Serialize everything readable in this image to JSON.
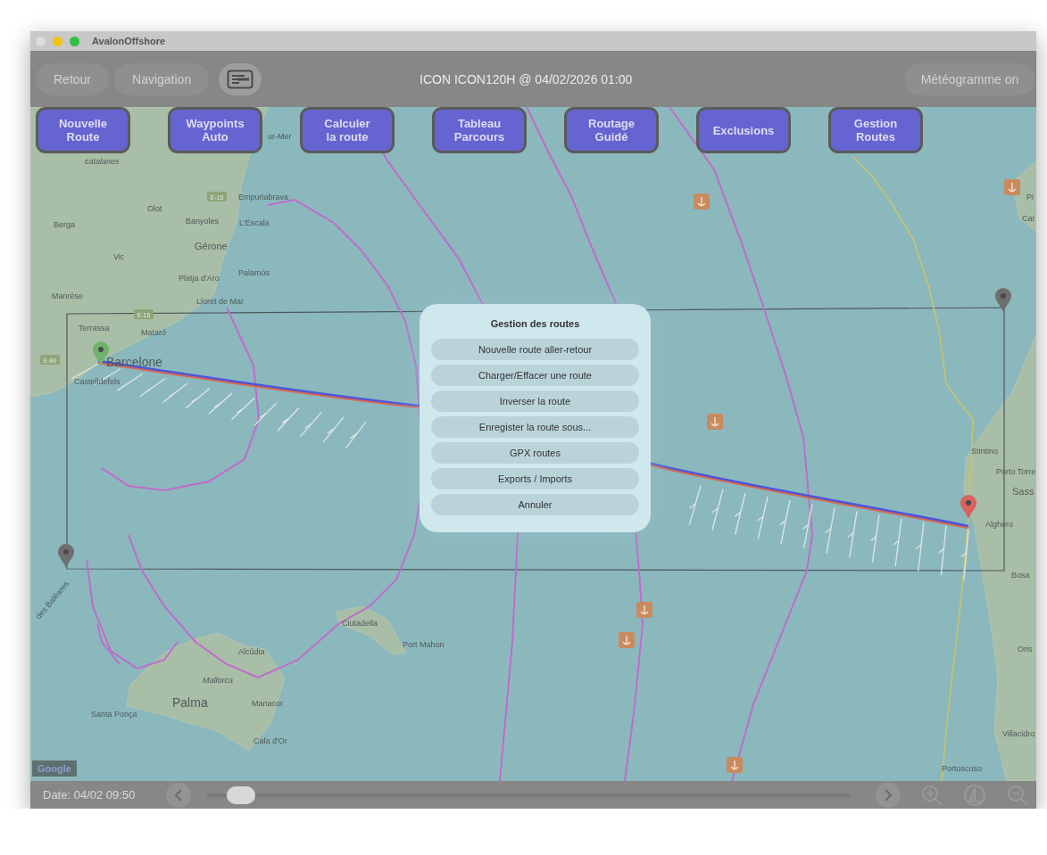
{
  "window": {
    "title": "AvalonOffshore",
    "traffic_lights": [
      {
        "color": "#dcdcdc"
      },
      {
        "color": "#f4c20d"
      },
      {
        "color": "#2fbf4a"
      }
    ]
  },
  "toolbar": {
    "buttons": [
      {
        "label": "Retour",
        "disabled": true
      },
      {
        "label": "Navigation",
        "disabled": true
      }
    ],
    "title": "ICON ICON120H @ 04/02/2026 01:00",
    "meteogram_button": {
      "label": "Météogramme on",
      "disabled": true
    }
  },
  "map_buttons": [
    {
      "label": "Nouvelle\nRoute"
    },
    {
      "label": "Waypoints\nAuto"
    },
    {
      "label": "Calculer\nla route"
    },
    {
      "label": "Tableau\nParcours"
    },
    {
      "label": "Routage\nGuidé"
    },
    {
      "label": "Exclusions"
    },
    {
      "label": "Gestion\nRoutes"
    }
  ],
  "map": {
    "labels": [
      {
        "text": "catalanes",
        "kind": "region"
      },
      {
        "text": "ur-Mer",
        "kind": "town"
      },
      {
        "text": "Empuriabrava",
        "kind": "town"
      },
      {
        "text": "Olot",
        "kind": "town"
      },
      {
        "text": "Berga",
        "kind": "town"
      },
      {
        "text": "Banyoles",
        "kind": "town"
      },
      {
        "text": "L'Escala",
        "kind": "town"
      },
      {
        "text": "Gérone",
        "kind": "city"
      },
      {
        "text": "Vic",
        "kind": "town"
      },
      {
        "text": "Platja d'Aro",
        "kind": "town"
      },
      {
        "text": "Palamós",
        "kind": "town"
      },
      {
        "text": "Manrèse",
        "kind": "town"
      },
      {
        "text": "Lloret de Mar",
        "kind": "town"
      },
      {
        "text": "Terrassa",
        "kind": "town"
      },
      {
        "text": "Mataró",
        "kind": "town"
      },
      {
        "text": "Barcelone",
        "kind": "capital"
      },
      {
        "text": "Castelldefels",
        "kind": "town"
      },
      {
        "text": "des Baléares",
        "kind": "sea"
      },
      {
        "text": "Ciutadella",
        "kind": "town"
      },
      {
        "text": "Port Mahon",
        "kind": "town"
      },
      {
        "text": "Alcúdia",
        "kind": "town"
      },
      {
        "text": "Mallorca",
        "kind": "region"
      },
      {
        "text": "Palma",
        "kind": "capital"
      },
      {
        "text": "Manacor",
        "kind": "town"
      },
      {
        "text": "Santa Ponça",
        "kind": "town"
      },
      {
        "text": "Cala d'Or",
        "kind": "town"
      },
      {
        "text": "Pi",
        "kind": "town"
      },
      {
        "text": "Car",
        "kind": "town"
      },
      {
        "text": "Stintino",
        "kind": "town"
      },
      {
        "text": "Porto Torre",
        "kind": "town"
      },
      {
        "text": "Sass",
        "kind": "city"
      },
      {
        "text": "Alghero",
        "kind": "town"
      },
      {
        "text": "Bosa",
        "kind": "town"
      },
      {
        "text": "Oris",
        "kind": "town"
      },
      {
        "text": "Villacidro",
        "kind": "town"
      },
      {
        "text": "Portoscuso",
        "kind": "town"
      }
    ],
    "road_signs": [
      "E-15",
      "E-15",
      "E-90"
    ],
    "pins": [
      {
        "color": "#6fb36a"
      },
      {
        "color": "#d9635c"
      },
      {
        "color": "#6e6e6e"
      },
      {
        "color": "#6e6e6e"
      }
    ],
    "attribution": "Google"
  },
  "dialog": {
    "title": "Gestion des routes",
    "options": [
      "Nouvelle route aller-retour",
      "Charger/Effacer une route",
      "Inverser la route",
      "Enregister la route sous...",
      "GPX routes",
      "Exports / Imports",
      "Annuler"
    ]
  },
  "bottom_bar": {
    "date": "Date: 04/02 09:50",
    "slider": {
      "level": 0.03
    }
  }
}
